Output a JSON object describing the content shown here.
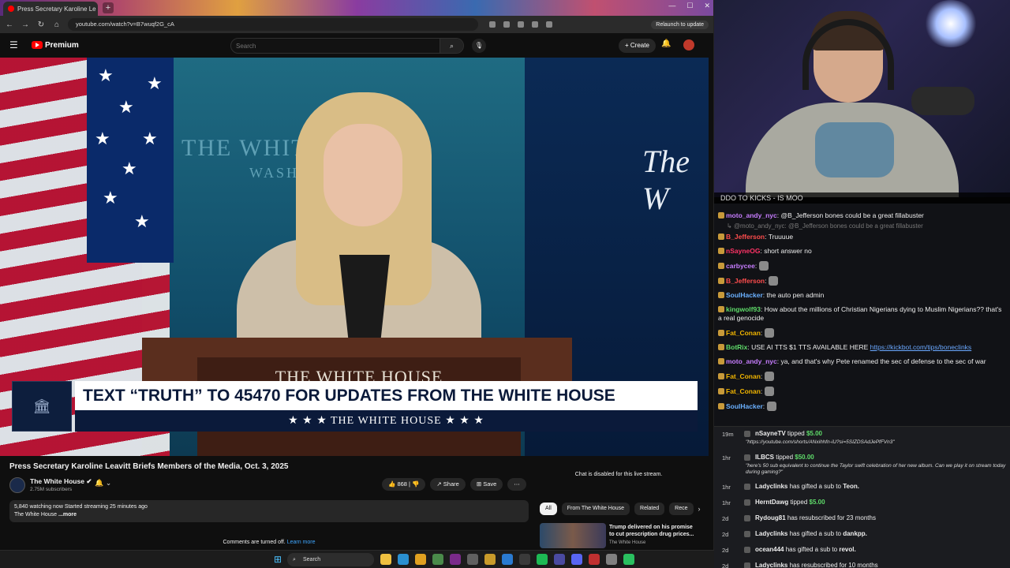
{
  "browser": {
    "tab_title": "Press Secretary Karoline Le",
    "url": "youtube.com/watch?v=B7wuqf2G_cA",
    "relaunch_label": "Relaunch to update"
  },
  "youtube": {
    "logo_text": "Premium",
    "search_placeholder": "Search",
    "create_label": "Create"
  },
  "video": {
    "backdrop_text": "THE WHITE HOUSE",
    "backdrop_sub": "WASHINGTON",
    "backdrop_right": "The W",
    "podium_label": "THE WHITE HOUSE",
    "lower_third_top": "TEXT “TRUTH” TO 45470 FOR UPDATES FROM THE WHITE HOUSE",
    "lower_third_bottom": "★ ★ ★  THE WHITE HOUSE  ★ ★ ★",
    "title": "Press Secretary Karoline Leavitt Briefs Members of the Media, Oct. 3, 2025",
    "channel_name": "The White House",
    "subscribers": "2.75M subscribers",
    "likes": "868",
    "share_label": "Share",
    "save_label": "Save",
    "desc_line1": "5,840 watching now  Started streaming 25 minutes ago",
    "desc_line2": "The White House ",
    "desc_more": "...more",
    "comments_off": "Comments are turned off. ",
    "learn_more": "Learn more"
  },
  "sidebar": {
    "chat_disabled": "Chat is disabled for this live stream.",
    "chips": [
      "All",
      "From The White House",
      "Related",
      "Rece"
    ],
    "rec_title": "Trump delivered on his promise to cut prescription drug prices...",
    "rec_channel": "The White House"
  },
  "stream": {
    "ticker": "DDO TO KICKS - IS MOO"
  },
  "chat": [
    {
      "user": "moto_andy_nyc",
      "color": "#c77dff",
      "text": "@B_Jefferson bones could be a great fillabuster"
    },
    {
      "reply": "@moto_andy_nyc: @B_Jefferson bones could be a great fillabuster"
    },
    {
      "user": "B_Jefferson",
      "color": "#ff4d4d",
      "text": "Truuuue"
    },
    {
      "user": "nSayneOG",
      "color": "#ff3366",
      "text": "short answer no"
    },
    {
      "user": "carbycee",
      "color": "#c77dff",
      "text": "",
      "emote": true
    },
    {
      "user": "B_Jefferson",
      "color": "#ff4d4d",
      "text": "",
      "emote": true
    },
    {
      "user": "SoulHacker",
      "color": "#6ab0ff",
      "text": "the auto pen admin"
    },
    {
      "user": "kingwolf93",
      "color": "#5fdc6a",
      "text": "How about the millions of Christian Nigerians dying to Muslim Nigerians?? that's a real genocide"
    },
    {
      "user": "Fat_Conan",
      "color": "#f0b400",
      "text": "",
      "emote": true
    },
    {
      "user": "BotRix",
      "color": "#5fdc6a",
      "text": "USE AI TTS $1 TTS AVAILABLE HERE ",
      "link": "https://kickbot.com/tips/boneclinks"
    },
    {
      "user": "moto_andy_nyc",
      "color": "#c77dff",
      "text": "ya, and that's why Pete renamed the sec of defense to the sec of war"
    },
    {
      "user": "Fat_Conan",
      "color": "#f0b400",
      "text": "",
      "emote": true
    },
    {
      "user": "Fat_Conan",
      "color": "#f0b400",
      "text": "",
      "emote": true
    },
    {
      "user": "SoulHacker",
      "color": "#6ab0ff",
      "text": "",
      "emote": true
    }
  ],
  "events": [
    {
      "time": "19m",
      "name": "nSayneTV",
      "action": "tipped",
      "amount": "$5.00",
      "sub": "\"https://youtube.com/shorts/ANxihhfn-iU?si=5SIZDSAdJePfFVn3\"",
      "kind": "tall"
    },
    {
      "time": "1hr",
      "name": "ILBCS",
      "action": "tipped",
      "amount": "$50.00",
      "sub": "\"here's 50 sub equivalent to continue the Taylor swift celebration of her new album. Can we play it on stream today during gaming?\"",
      "kind": "tall2"
    },
    {
      "time": "1hr",
      "name": "Ladyclinks",
      "action": "has gifted a sub to",
      "target": "Teon."
    },
    {
      "time": "1hr",
      "name": "HerntDawg",
      "action": "tipped",
      "amount": "$5.00"
    },
    {
      "time": "2d",
      "name": "Rydoug81",
      "action": "has resubscribed for 23 months"
    },
    {
      "time": "2d",
      "name": "Ladyclinks",
      "action": "has gifted a sub to",
      "target": "dankpp."
    },
    {
      "time": "2d",
      "name": "ocean444",
      "action": "has gifted a sub to",
      "target": "revol."
    },
    {
      "time": "2d",
      "name": "Ladyclinks",
      "action": "has resubscribed for 10 months"
    }
  ],
  "taskbar": {
    "search_label": "Search"
  }
}
